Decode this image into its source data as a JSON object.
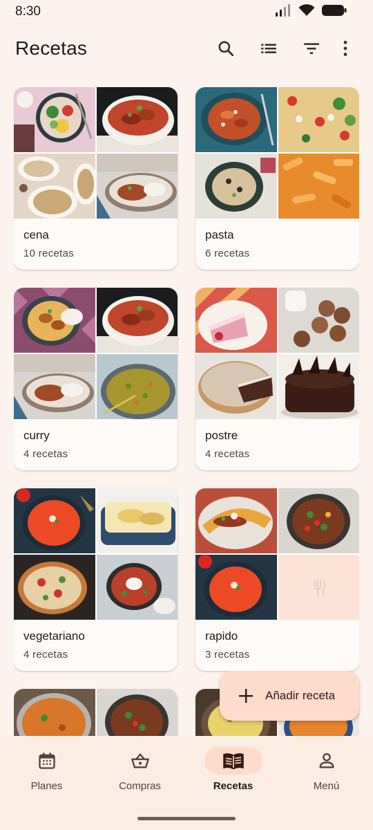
{
  "status_bar": {
    "time": "8:30"
  },
  "app_bar": {
    "title": "Recetas",
    "actions": [
      "search-icon",
      "list-view-icon",
      "filter-icon",
      "more-vert-icon"
    ]
  },
  "collections": [
    {
      "name": "cena",
      "count": "10 recetas",
      "images": [
        "bowl",
        "curry",
        "pasta",
        "curry-rice"
      ]
    },
    {
      "name": "pasta",
      "count": "6 recetas",
      "images": [
        "pasta-bowl",
        "pasta-salad",
        "pasta-plate",
        "penne"
      ]
    },
    {
      "name": "curry",
      "count": "4 recetas",
      "images": [
        "curry-bowl",
        "curry",
        "curry-rice",
        "lentils"
      ]
    },
    {
      "name": "postre",
      "count": "4 recetas",
      "images": [
        "cake-slice",
        "cookies",
        "tart",
        "chocolate-cake"
      ]
    },
    {
      "name": "vegetariano",
      "count": "4 recetas",
      "images": [
        "soup",
        "casserole",
        "pizza",
        "skillet"
      ]
    },
    {
      "name": "rapido",
      "count": "3 recetas",
      "images": [
        "tacos",
        "stir-fry",
        "soup",
        "placeholder"
      ]
    },
    {
      "name": "",
      "count": "",
      "images": [
        "curry-pot",
        "stir-fry",
        "",
        ""
      ]
    },
    {
      "name": "",
      "count": "",
      "images": [
        "rice-bowl",
        "soup",
        "",
        ""
      ]
    }
  ],
  "fab": {
    "label": "Añadir receta",
    "icon": "plus-icon"
  },
  "bottom_nav": [
    {
      "label": "Planes",
      "icon": "calendar-icon",
      "active": false
    },
    {
      "label": "Compras",
      "icon": "basket-icon",
      "active": false
    },
    {
      "label": "Recetas",
      "icon": "book-icon",
      "active": true
    },
    {
      "label": "Menú",
      "icon": "person-icon",
      "active": false
    }
  ],
  "colors": {
    "background": "#fdf3ee",
    "card": "#fefaf8",
    "fab": "#ffdbcc",
    "active_pill": "#ffdbcc",
    "nav_bar": "#fbece4"
  }
}
